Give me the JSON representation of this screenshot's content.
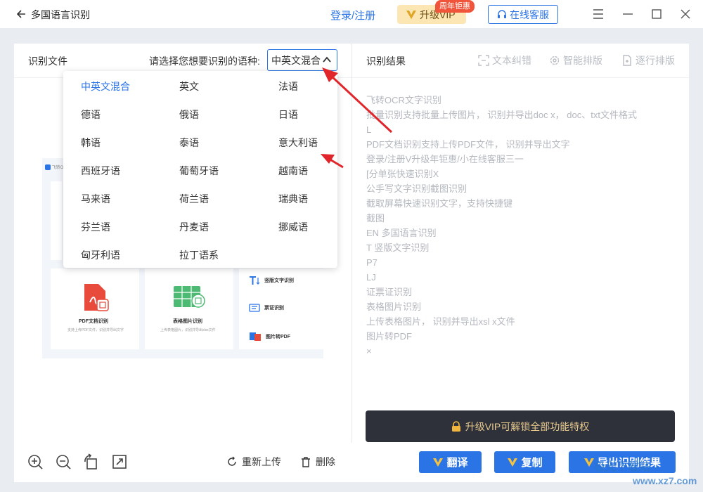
{
  "titlebar": {
    "app_title": "多国语言识别",
    "login": "登录/注册",
    "vip": "升级VIP",
    "promo_badge": "周年钜惠",
    "service": "在线客服"
  },
  "left": {
    "file_label": "识别文件",
    "language_prompt": "请选择您想要识别的语种:",
    "selected_language": "中英文混合",
    "languages": [
      "中英文混合",
      "英文",
      "法语",
      "德语",
      "俄语",
      "日语",
      "韩语",
      "泰语",
      "意大利语",
      "西班牙语",
      "葡萄牙语",
      "越南语",
      "马来语",
      "荷兰语",
      "瑞典语",
      "芬兰语",
      "丹麦语",
      "挪威语",
      "匈牙利语",
      "拉丁语系"
    ],
    "preview": {
      "logo": "飞转OCR",
      "pdf_title": "PDF文档识别",
      "pdf_sub": "支持上传PDF文件，识别并导出文字",
      "table_title": "表格图片识别",
      "table_sub": "上传表格图片，识别并导出xlsx文件",
      "vertical": "竖版文字识别",
      "ticket": "票证识别",
      "img2pdf": "图片转PDF"
    }
  },
  "right": {
    "result_label": "识别结果",
    "tools": [
      "文本纠错",
      "智能排版",
      "逐行排版"
    ],
    "result_lines": [
      "飞转OCR文字识别",
      "批量识别支持批量上传图片， 识别并导出doc x， doc、txt文件格式",
      "L",
      "PDF文档识别支持上传PDF文件， 识别并导出文字",
      "登录/注册V升级年钜惠/小在线客服三一",
      "[分单张快速识别X",
      "公手写文字识别截图识别",
      "截取屏幕快速识别文字，支持快捷键",
      "截图",
      "EN 多国语言识别",
      "T 竖版文字识别",
      "P7",
      "LJ",
      "证票证识别",
      "表格图片识别",
      "上传表格图片， 识别并导出xsl x文件",
      "图片转PDF",
      "×"
    ],
    "vip_unlock": "升级VIP可解锁全部功能特权"
  },
  "bottom": {
    "reupload": "重新上传",
    "delete": "删除",
    "translate": "翻译",
    "copy": "复制",
    "export": "导出识别结果"
  },
  "watermark": {
    "line1": "极光下载站",
    "line2": "www.xz7.com"
  },
  "colors": {
    "accent": "#2b74e6",
    "vip_gold": "#fbe6b4",
    "badge_red": "#f0553c",
    "arrow_red": "#e0262b"
  }
}
